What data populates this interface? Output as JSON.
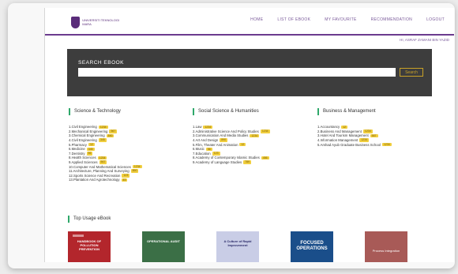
{
  "header": {
    "logo_text": "UNIVERSITI TEKNOLOGI MARA",
    "nav": [
      "Home",
      "List of eBook",
      "My Favourite",
      "Recommendation",
      "Logout"
    ],
    "user": "Hi, ASRAF ZAMANI BIN YAZID"
  },
  "search": {
    "title": "SEARCH EBOOK",
    "placeholder": "",
    "button_label": "Search"
  },
  "categories": [
    {
      "title": "Science & Technology",
      "items": [
        {
          "label": "1.Civil Engineering",
          "count": "1234"
        },
        {
          "label": "2.Mechanical Engineering",
          "count": "567"
        },
        {
          "label": "3.Chemical Engineering",
          "count": "890"
        },
        {
          "label": "4.Civil Engineering",
          "count": "345"
        },
        {
          "label": "5.Pharmacy",
          "count": "12"
        },
        {
          "label": "6.Medicine",
          "count": "345"
        },
        {
          "label": "7.Dentistry",
          "count": "56"
        },
        {
          "label": "8.Health Sciences",
          "count": "1234"
        },
        {
          "label": "9.Applied Sciences",
          "count": "567"
        },
        {
          "label": "10.Computer And Mathematical Sciences",
          "count": "1234"
        },
        {
          "label": "11.Architecture, Planning And Surveying",
          "count": "890"
        },
        {
          "label": "12.Sports Science And Recreation",
          "count": "123"
        },
        {
          "label": "13.Plantation And Agrotechnology",
          "count": "45"
        }
      ]
    },
    {
      "title": "Social Science & Humanities",
      "items": [
        {
          "label": "1.Law",
          "count": "1234"
        },
        {
          "label": "2.Administrative Science And Policy Studies",
          "count": "1234"
        },
        {
          "label": "3.Communication And Media Studies",
          "count": "1234"
        },
        {
          "label": "4.Art And Design",
          "count": "890"
        },
        {
          "label": "5.Film, Theater And Animation",
          "count": "12"
        },
        {
          "label": "6.Music",
          "count": "56"
        },
        {
          "label": "7.Education",
          "count": "123"
        },
        {
          "label": "8.Academy of Contemporary Islamic Studies",
          "count": "456"
        },
        {
          "label": "9.Academy of Language Studies",
          "count": "789"
        }
      ]
    },
    {
      "title": "Business & Management",
      "items": [
        {
          "label": "1.Accountancy",
          "count": "12"
        },
        {
          "label": "2.Business And Management",
          "count": "1234"
        },
        {
          "label": "3.Hotel And Tourism Management",
          "count": "567"
        },
        {
          "label": "4.Information Management",
          "count": "1234"
        },
        {
          "label": "5.Arshad Ayub Graduate Business School",
          "count": "1234"
        }
      ]
    }
  ],
  "top_usage": {
    "title": "Top Usage eBook",
    "books": [
      {
        "title": "Handbook of Pollution Prevention"
      },
      {
        "title": "Operational Audit"
      },
      {
        "title": "A Culture of Rapid Improvement"
      },
      {
        "title": "Focused Operations"
      },
      {
        "title": "Process Integration"
      }
    ]
  },
  "colors": {
    "accent": "#6b3b8e",
    "search_band": "#3d3d3d",
    "badge": "#f1cf3f",
    "section_marker": "#2fa86a"
  }
}
